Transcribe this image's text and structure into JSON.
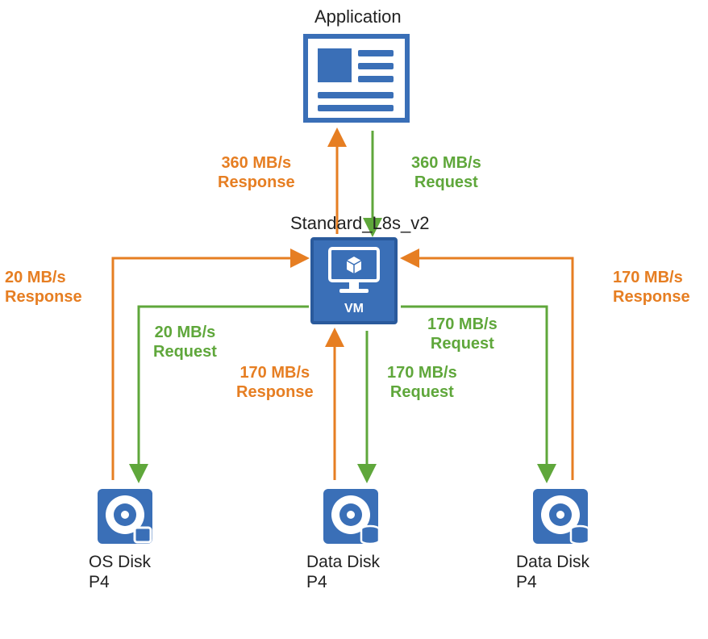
{
  "nodes": {
    "application": {
      "title": "Application"
    },
    "vm": {
      "title": "Standard_L8s_v2",
      "label": "VM"
    },
    "os_disk": {
      "title": "OS Disk",
      "tier": "P4"
    },
    "data_disk_1": {
      "title": "Data Disk",
      "tier": "P4"
    },
    "data_disk_2": {
      "title": "Data Disk",
      "tier": "P4"
    }
  },
  "flows": {
    "app_to_vm": {
      "request": {
        "rate": "360 MB/s",
        "type": "Request"
      },
      "response": {
        "rate": "360 MB/s",
        "type": "Response"
      }
    },
    "vm_to_os_disk": {
      "request": {
        "rate": "20 MB/s",
        "type": "Request"
      },
      "response": {
        "rate": "20 MB/s",
        "type": "Response"
      }
    },
    "vm_to_data_disk_1": {
      "request": {
        "rate": "170 MB/s",
        "type": "Request"
      },
      "response": {
        "rate": "170 MB/s",
        "type": "Response"
      }
    },
    "vm_to_data_disk_2": {
      "request": {
        "rate": "170 MB/s",
        "type": "Request"
      },
      "response": {
        "rate": "170 MB/s",
        "type": "Response"
      }
    }
  },
  "colors": {
    "node_blue": "#3a6fb7",
    "request_green": "#5fa73b",
    "response_orange": "#e67e22"
  }
}
